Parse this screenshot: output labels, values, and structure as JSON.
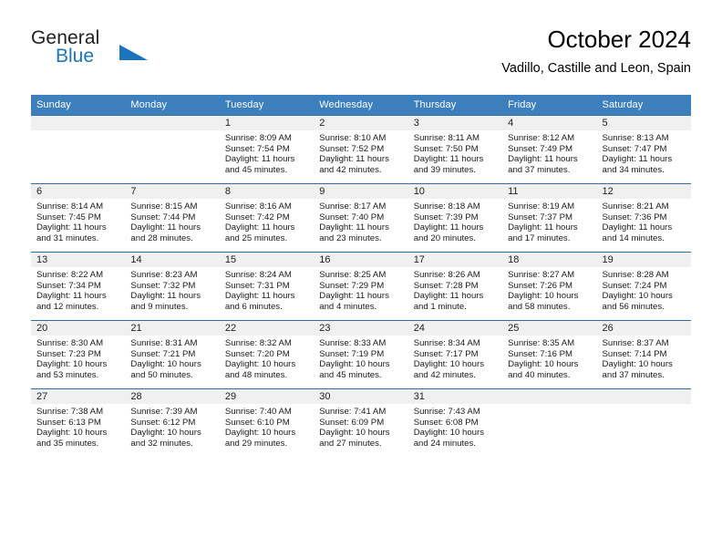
{
  "logo": {
    "word_top": "General",
    "word_bottom": "Blue",
    "triangle_color": "#1b75bb"
  },
  "header": {
    "title": "October 2024",
    "subtitle": "Vadillo, Castille and Leon, Spain"
  },
  "theme": {
    "header_bg": "#3d7ebd",
    "row_divider": "#2e6ca4",
    "date_band": "#f0f0f0",
    "logo_blue": "#1b75bb"
  },
  "calendar": {
    "weekday_headers": [
      "Sunday",
      "Monday",
      "Tuesday",
      "Wednesday",
      "Thursday",
      "Friday",
      "Saturday"
    ],
    "weeks": [
      [
        {
          "day": "",
          "info": ""
        },
        {
          "day": "",
          "info": ""
        },
        {
          "day": "1",
          "info": "Sunrise: 8:09 AM\nSunset: 7:54 PM\nDaylight: 11 hours\nand 45 minutes."
        },
        {
          "day": "2",
          "info": "Sunrise: 8:10 AM\nSunset: 7:52 PM\nDaylight: 11 hours\nand 42 minutes."
        },
        {
          "day": "3",
          "info": "Sunrise: 8:11 AM\nSunset: 7:50 PM\nDaylight: 11 hours\nand 39 minutes."
        },
        {
          "day": "4",
          "info": "Sunrise: 8:12 AM\nSunset: 7:49 PM\nDaylight: 11 hours\nand 37 minutes."
        },
        {
          "day": "5",
          "info": "Sunrise: 8:13 AM\nSunset: 7:47 PM\nDaylight: 11 hours\nand 34 minutes."
        }
      ],
      [
        {
          "day": "6",
          "info": "Sunrise: 8:14 AM\nSunset: 7:45 PM\nDaylight: 11 hours\nand 31 minutes."
        },
        {
          "day": "7",
          "info": "Sunrise: 8:15 AM\nSunset: 7:44 PM\nDaylight: 11 hours\nand 28 minutes."
        },
        {
          "day": "8",
          "info": "Sunrise: 8:16 AM\nSunset: 7:42 PM\nDaylight: 11 hours\nand 25 minutes."
        },
        {
          "day": "9",
          "info": "Sunrise: 8:17 AM\nSunset: 7:40 PM\nDaylight: 11 hours\nand 23 minutes."
        },
        {
          "day": "10",
          "info": "Sunrise: 8:18 AM\nSunset: 7:39 PM\nDaylight: 11 hours\nand 20 minutes."
        },
        {
          "day": "11",
          "info": "Sunrise: 8:19 AM\nSunset: 7:37 PM\nDaylight: 11 hours\nand 17 minutes."
        },
        {
          "day": "12",
          "info": "Sunrise: 8:21 AM\nSunset: 7:36 PM\nDaylight: 11 hours\nand 14 minutes."
        }
      ],
      [
        {
          "day": "13",
          "info": "Sunrise: 8:22 AM\nSunset: 7:34 PM\nDaylight: 11 hours\nand 12 minutes."
        },
        {
          "day": "14",
          "info": "Sunrise: 8:23 AM\nSunset: 7:32 PM\nDaylight: 11 hours\nand 9 minutes."
        },
        {
          "day": "15",
          "info": "Sunrise: 8:24 AM\nSunset: 7:31 PM\nDaylight: 11 hours\nand 6 minutes."
        },
        {
          "day": "16",
          "info": "Sunrise: 8:25 AM\nSunset: 7:29 PM\nDaylight: 11 hours\nand 4 minutes."
        },
        {
          "day": "17",
          "info": "Sunrise: 8:26 AM\nSunset: 7:28 PM\nDaylight: 11 hours\nand 1 minute."
        },
        {
          "day": "18",
          "info": "Sunrise: 8:27 AM\nSunset: 7:26 PM\nDaylight: 10 hours\nand 58 minutes."
        },
        {
          "day": "19",
          "info": "Sunrise: 8:28 AM\nSunset: 7:24 PM\nDaylight: 10 hours\nand 56 minutes."
        }
      ],
      [
        {
          "day": "20",
          "info": "Sunrise: 8:30 AM\nSunset: 7:23 PM\nDaylight: 10 hours\nand 53 minutes."
        },
        {
          "day": "21",
          "info": "Sunrise: 8:31 AM\nSunset: 7:21 PM\nDaylight: 10 hours\nand 50 minutes."
        },
        {
          "day": "22",
          "info": "Sunrise: 8:32 AM\nSunset: 7:20 PM\nDaylight: 10 hours\nand 48 minutes."
        },
        {
          "day": "23",
          "info": "Sunrise: 8:33 AM\nSunset: 7:19 PM\nDaylight: 10 hours\nand 45 minutes."
        },
        {
          "day": "24",
          "info": "Sunrise: 8:34 AM\nSunset: 7:17 PM\nDaylight: 10 hours\nand 42 minutes."
        },
        {
          "day": "25",
          "info": "Sunrise: 8:35 AM\nSunset: 7:16 PM\nDaylight: 10 hours\nand 40 minutes."
        },
        {
          "day": "26",
          "info": "Sunrise: 8:37 AM\nSunset: 7:14 PM\nDaylight: 10 hours\nand 37 minutes."
        }
      ],
      [
        {
          "day": "27",
          "info": "Sunrise: 7:38 AM\nSunset: 6:13 PM\nDaylight: 10 hours\nand 35 minutes."
        },
        {
          "day": "28",
          "info": "Sunrise: 7:39 AM\nSunset: 6:12 PM\nDaylight: 10 hours\nand 32 minutes."
        },
        {
          "day": "29",
          "info": "Sunrise: 7:40 AM\nSunset: 6:10 PM\nDaylight: 10 hours\nand 29 minutes."
        },
        {
          "day": "30",
          "info": "Sunrise: 7:41 AM\nSunset: 6:09 PM\nDaylight: 10 hours\nand 27 minutes."
        },
        {
          "day": "31",
          "info": "Sunrise: 7:43 AM\nSunset: 6:08 PM\nDaylight: 10 hours\nand 24 minutes."
        },
        {
          "day": "",
          "info": ""
        },
        {
          "day": "",
          "info": ""
        }
      ]
    ]
  }
}
